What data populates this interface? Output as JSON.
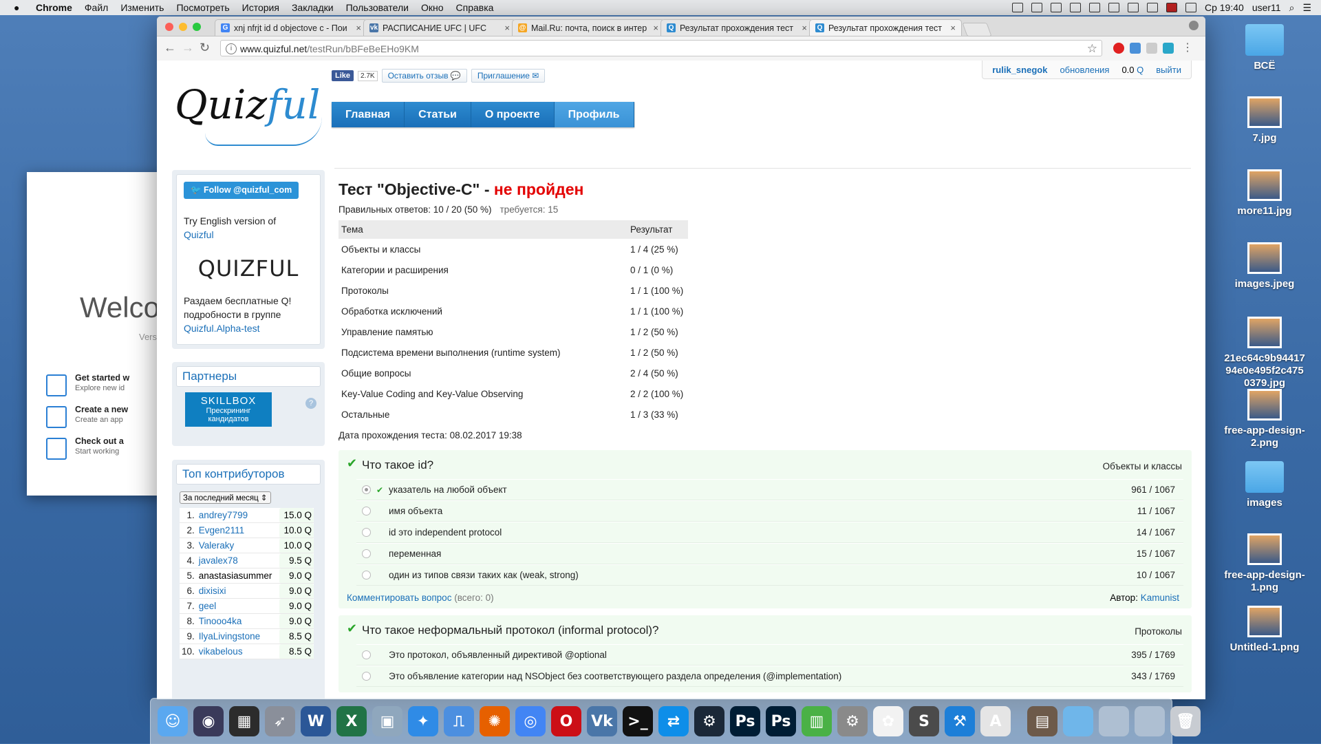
{
  "menubar": {
    "app": "Chrome",
    "items": [
      "Файл",
      "Изменить",
      "Посмотреть",
      "История",
      "Закладки",
      "Пользователи",
      "Окно",
      "Справка"
    ],
    "clock": "Ср 19:40",
    "user": "user11"
  },
  "xcode": {
    "welcome": "Welco",
    "version": "Vers",
    "items": [
      {
        "title": "Get started w",
        "sub": "Explore new id"
      },
      {
        "title": "Create a new",
        "sub": "Create an app"
      },
      {
        "title": "Check out a",
        "sub": "Start working"
      }
    ]
  },
  "desktop_icons": [
    {
      "label": "ВСЁ",
      "icon": "folder-icon"
    },
    {
      "label": "7.jpg",
      "icon": "image-icon"
    },
    {
      "label": "more11.jpg",
      "icon": "image-icon"
    },
    {
      "label": "images.jpeg",
      "icon": "image-icon"
    },
    {
      "label": "21ec64c9b9441794e0e495f2c4750379.jpg",
      "icon": "image-icon"
    },
    {
      "label": "free-app-design-2.png",
      "icon": "image-icon"
    },
    {
      "label": "images",
      "icon": "folder-icon"
    },
    {
      "label": "free-app-design-1.png",
      "icon": "image-icon"
    },
    {
      "label": "Untitled-1.png",
      "icon": "image-icon"
    }
  ],
  "browser": {
    "tabs": [
      {
        "title": "xnj nfrjt id d objectove c - Пои",
        "favicon": "G",
        "color": "#4285f4"
      },
      {
        "title": "РАСПИСАНИЕ UFC | UFC",
        "favicon": "vk",
        "color": "#4a76a8"
      },
      {
        "title": "Mail.Ru: почта, поиск в интер",
        "favicon": "@",
        "color": "#f5a623"
      },
      {
        "title": "Результат прохождения тест",
        "favicon": "Q",
        "color": "#2d8bd0"
      },
      {
        "title": "Результат прохождения тест",
        "favicon": "Q",
        "color": "#2d8bd0"
      }
    ],
    "url_host": "www.quizful.net",
    "url_path": "/testRun/bBFeBeEHo9KM"
  },
  "site": {
    "logo_a": "Quiz",
    "logo_b": "ful",
    "fb_like": "Like",
    "fb_count": "2.7K",
    "feedback": "Оставить отзыв",
    "invite": "Приглашение",
    "username": "rulik_snegok",
    "updates": "обновления",
    "balance": "0.0",
    "balance_unit": "Q",
    "logout": "выйти",
    "menu": [
      "Главная",
      "Статьи",
      "О проекте",
      "Профиль"
    ]
  },
  "sidebar": {
    "twitter": "Follow @quizful_com",
    "english_text": "Try English version of",
    "english_link": "Quizful",
    "brand": "QUIZFUL",
    "promo1": "Раздаем бесплатные Q!",
    "promo2": "подробности в группе",
    "promo_link": "Quizful.Alpha-test",
    "partners_title": "Партнеры",
    "skillbox_name": "SKILLBOX",
    "skillbox_sub": "Прескрининг кандидатов",
    "top_title": "Топ контрибуторов",
    "period": "За последний месяц",
    "contributors": [
      {
        "n": "1.",
        "name": "andrey7799",
        "q": "15.0 Q",
        "link": true
      },
      {
        "n": "2.",
        "name": "Evgen2111",
        "q": "10.0 Q",
        "link": true
      },
      {
        "n": "3.",
        "name": "Valeraky",
        "q": "10.0 Q",
        "link": true
      },
      {
        "n": "4.",
        "name": "javalex78",
        "q": "9.5 Q",
        "link": true
      },
      {
        "n": "5.",
        "name": "anastasiasummer",
        "q": "9.0 Q",
        "link": false
      },
      {
        "n": "6.",
        "name": "dixisixi",
        "q": "9.0 Q",
        "link": true
      },
      {
        "n": "7.",
        "name": "geel",
        "q": "9.0 Q",
        "link": true
      },
      {
        "n": "8.",
        "name": "Tinooo4ka",
        "q": "9.0 Q",
        "link": true
      },
      {
        "n": "9.",
        "name": "IlyaLivingstone",
        "q": "8.5 Q",
        "link": true
      },
      {
        "n": "10.",
        "name": "vikabelous",
        "q": "8.5 Q",
        "link": true
      }
    ]
  },
  "result": {
    "title_prefix": "Тест \"Objective-C\" -",
    "title_status": "не пройден",
    "correct": "Правильных ответов: 10 / 20 (50 %)",
    "required": "требуется: 15",
    "col_topic": "Тема",
    "col_result": "Результат",
    "rows": [
      {
        "topic": "Объекты и классы",
        "result": "1 / 4 (25 %)"
      },
      {
        "topic": "Категории и расширения",
        "result": "0 / 1 (0 %)"
      },
      {
        "topic": "Протоколы",
        "result": "1 / 1 (100 %)"
      },
      {
        "topic": "Обработка исключений",
        "result": "1 / 1 (100 %)"
      },
      {
        "topic": "Управление памятью",
        "result": "1 / 2 (50 %)"
      },
      {
        "topic": "Подсистема времени выполнения (runtime system)",
        "result": "1 / 2 (50 %)"
      },
      {
        "topic": "Общие вопросы",
        "result": "2 / 4 (50 %)"
      },
      {
        "topic": "Key-Value Coding and Key-Value Observing",
        "result": "2 / 2 (100 %)"
      },
      {
        "topic": "Остальные",
        "result": "1 / 3 (33 %)"
      }
    ],
    "date": "Дата прохождения теста: 08.02.2017 19:38"
  },
  "questions": [
    {
      "title": "Что такое id?",
      "topic": "Объекты и классы",
      "answers": [
        {
          "text": "указатель на любой объект",
          "count": "961 / 1067",
          "chosen": true
        },
        {
          "text": "имя объекта",
          "count": "11 / 1067",
          "chosen": false
        },
        {
          "text": "id это independent protocol",
          "count": "14 / 1067",
          "chosen": false
        },
        {
          "text": "переменная",
          "count": "15 / 1067",
          "chosen": false
        },
        {
          "text": "один из типов связи таких как (weak, strong)",
          "count": "10 / 1067",
          "chosen": false
        }
      ],
      "comment": "Комментировать вопрос",
      "comment_count": "(всего: 0)",
      "author_label": "Автор:",
      "author": "Kamunist"
    },
    {
      "title": "Что такое неформальный протокол (informal protocol)?",
      "topic": "Протоколы",
      "answers": [
        {
          "text": "Это протокол, объявленный директивой @optional",
          "count": "395 / 1769",
          "chosen": false
        },
        {
          "text": "Это объявление категории над NSObject без соответствующего раздела определения (@implementation)",
          "count": "343 / 1769",
          "chosen": false
        }
      ]
    }
  ],
  "dock": [
    {
      "name": "finder",
      "color": "#5aa8f0",
      "g": "☺"
    },
    {
      "name": "siri",
      "color": "#3a3a5a",
      "g": "◉"
    },
    {
      "name": "mission-control",
      "color": "#2c2c2c",
      "g": "▦"
    },
    {
      "name": "launchpad",
      "color": "#8a8f9a",
      "g": "➶"
    },
    {
      "name": "word",
      "color": "#2b5797",
      "g": "W"
    },
    {
      "name": "excel",
      "color": "#217346",
      "g": "X"
    },
    {
      "name": "preview",
      "color": "#8fa7bd",
      "g": "▣"
    },
    {
      "name": "safari",
      "color": "#2f8be6",
      "g": "✦"
    },
    {
      "name": "keynote",
      "color": "#4c8fe0",
      "g": "⎍"
    },
    {
      "name": "firefox",
      "color": "#e66000",
      "g": "✺"
    },
    {
      "name": "chrome",
      "color": "#4285f4",
      "g": "◎"
    },
    {
      "name": "opera",
      "color": "#cc0f16",
      "g": "O"
    },
    {
      "name": "vk",
      "color": "#4a76a8",
      "g": "Vk"
    },
    {
      "name": "terminal",
      "color": "#111111",
      "g": ">_"
    },
    {
      "name": "teamviewer",
      "color": "#0e8ee9",
      "g": "⇄"
    },
    {
      "name": "steam",
      "color": "#1b2838",
      "g": "⚙"
    },
    {
      "name": "photoshop-1",
      "color": "#001d34",
      "g": "Ps"
    },
    {
      "name": "photoshop-2",
      "color": "#001d34",
      "g": "Ps"
    },
    {
      "name": "numbers",
      "color": "#4ab146",
      "g": "▥"
    },
    {
      "name": "system-preferences",
      "color": "#8a8a8a",
      "g": "⚙"
    },
    {
      "name": "photos",
      "color": "#f2f2f2",
      "g": "✿"
    },
    {
      "name": "sublime",
      "color": "#4b4b4b",
      "g": "S"
    },
    {
      "name": "xcode",
      "color": "#1d7fd8",
      "g": "⚒"
    },
    {
      "name": "acrobat",
      "color": "#e5e5e5",
      "g": "A"
    },
    {
      "name": "downloads-stack",
      "color": "#6d5a4a",
      "g": "▤"
    },
    {
      "name": "folder-1",
      "color": "#6fb6ea",
      "g": ""
    },
    {
      "name": "folder-2",
      "color": "#aebfd2",
      "g": ""
    },
    {
      "name": "folder-3",
      "color": "#aebfd2",
      "g": ""
    },
    {
      "name": "trash",
      "color": "#c8ccd2",
      "g": "🗑"
    }
  ]
}
